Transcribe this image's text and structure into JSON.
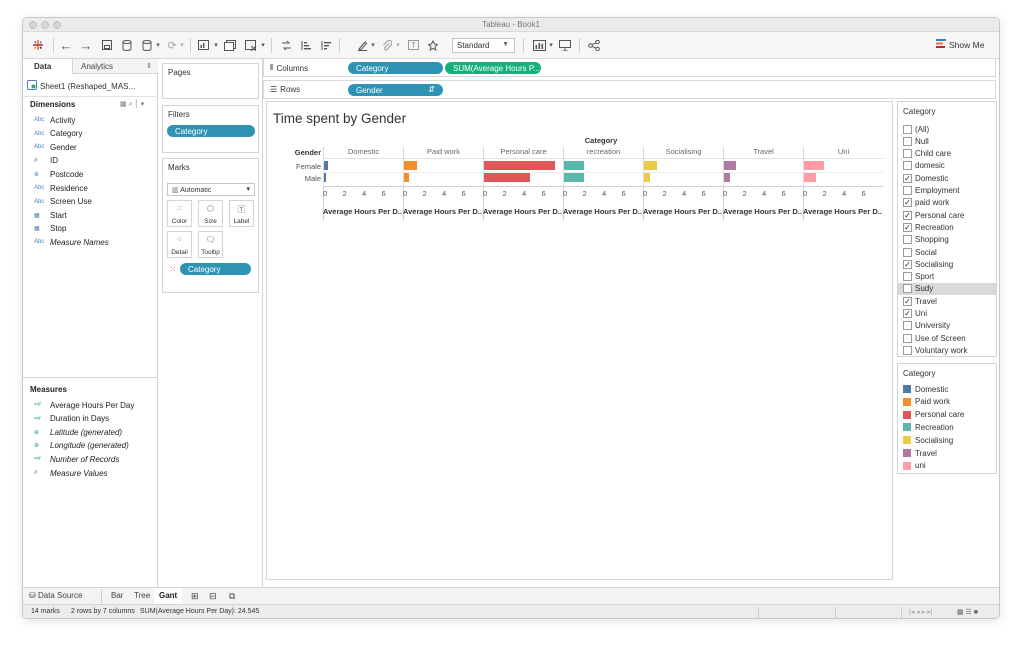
{
  "window": {
    "title": "Tableau - Book1"
  },
  "toolbar": {
    "zoom_select": "Standard",
    "show_me_label": "Show Me"
  },
  "sidebar": {
    "tab_data": "Data",
    "tab_analytics": "Analytics",
    "datasource": "Sheet1 (Reshaped_MAS...",
    "dimensions_title": "Dimensions",
    "dimensions": [
      {
        "type": "Abc",
        "name": "Activity"
      },
      {
        "type": "Abc",
        "name": "Category"
      },
      {
        "type": "Abc",
        "name": "Gender"
      },
      {
        "type": "#",
        "name": "ID"
      },
      {
        "type": "globe",
        "name": "Postcode"
      },
      {
        "type": "Abc",
        "name": "Residence"
      },
      {
        "type": "Abc",
        "name": "Screen Use"
      },
      {
        "type": "date",
        "name": "Start"
      },
      {
        "type": "date",
        "name": "Stop"
      },
      {
        "type": "Abc",
        "name": "Measure Names"
      }
    ],
    "measures_title": "Measures",
    "measures": [
      {
        "type": "=#",
        "name": "Average Hours Per Day"
      },
      {
        "type": "=#",
        "name": "Duration in Days"
      },
      {
        "type": "globe",
        "name": "Latitude (generated)"
      },
      {
        "type": "globe",
        "name": "Longitude (generated)"
      },
      {
        "type": "=#",
        "name": "Number of Records"
      },
      {
        "type": "#",
        "name": "Measure Values"
      }
    ]
  },
  "cards": {
    "pages": "Pages",
    "filters": "Filters",
    "filter_pill": "Category",
    "marks": "Marks",
    "mark_type": "Automatic",
    "mark_buttons": [
      "Color",
      "Size",
      "Label",
      "Detail",
      "Tooltip"
    ],
    "color_pill": "Category"
  },
  "shelves": {
    "columns_label": "Columns",
    "rows_label": "Rows",
    "col_pill_1": "Category",
    "col_pill_2": "SUM(Average Hours P...",
    "row_pill": "Gender"
  },
  "view": {
    "title": "Time spent by Gender",
    "category_header": "Category",
    "gender_header": "Gender",
    "axis_label": "Average Hours Per D..",
    "ticks": [
      "0",
      "2",
      "4",
      "6"
    ]
  },
  "chart_data": {
    "type": "bar",
    "title": "Time spent by Gender",
    "panel_header": "Category",
    "row_header": "Gender",
    "categories": [
      "Domestic",
      "Paid work",
      "Personal care",
      "recreation",
      "Socialising",
      "Travel",
      "Uni"
    ],
    "rows": [
      "Female",
      "Male"
    ],
    "series": [
      {
        "name": "Female",
        "values": [
          0.4,
          1.3,
          7.3,
          2.0,
          1.3,
          1.2,
          2.0
        ]
      },
      {
        "name": "Male",
        "values": [
          0.2,
          0.5,
          4.7,
          2.0,
          0.6,
          0.6,
          1.2
        ]
      }
    ],
    "colors": [
      "#4e79a7",
      "#f28e2b",
      "#e15759",
      "#59b8ab",
      "#edc948",
      "#b07aa1",
      "#ff9da7"
    ],
    "xlabel": "Average Hours Per D..",
    "ylabel": "",
    "xlim": [
      0,
      8
    ],
    "xticks": [
      0,
      2,
      4,
      6
    ],
    "grid": true
  },
  "filter_card": {
    "title": "Category",
    "items": [
      {
        "label": "(All)",
        "checked": false
      },
      {
        "label": "Null",
        "checked": false
      },
      {
        "label": "Child care",
        "checked": false
      },
      {
        "label": "domesic",
        "checked": false
      },
      {
        "label": "Domestic",
        "checked": true
      },
      {
        "label": "Employment",
        "checked": false
      },
      {
        "label": "paid work",
        "checked": true
      },
      {
        "label": "Personal care",
        "checked": true
      },
      {
        "label": "Recreation",
        "checked": true
      },
      {
        "label": "Shopping",
        "checked": false
      },
      {
        "label": "Social",
        "checked": false
      },
      {
        "label": "Socialising",
        "checked": true
      },
      {
        "label": "Sport",
        "checked": false
      },
      {
        "label": "Sudy",
        "checked": false
      },
      {
        "label": "Travel",
        "checked": true
      },
      {
        "label": "Uni",
        "checked": true
      },
      {
        "label": "University",
        "checked": false
      },
      {
        "label": "Use of Screen",
        "checked": false
      },
      {
        "label": "Voluntary work",
        "checked": false
      }
    ],
    "highlighted": "Sudy"
  },
  "legend": {
    "title": "Category",
    "items": [
      {
        "label": "Domestic",
        "color": "#4e79a7"
      },
      {
        "label": "Paid work",
        "color": "#f28e2b"
      },
      {
        "label": "Personal care",
        "color": "#e15759"
      },
      {
        "label": "Recreation",
        "color": "#59b8ab"
      },
      {
        "label": "Socialising",
        "color": "#edc948"
      },
      {
        "label": "Travel",
        "color": "#b07aa1"
      },
      {
        "label": "uni",
        "color": "#ff9da7"
      }
    ]
  },
  "sheet_tabs": {
    "datasource": "Data Source",
    "tabs": [
      "Bar",
      "Tree",
      "Gant"
    ],
    "active": "Gant"
  },
  "status": {
    "marks": "14 marks",
    "dims": "2 rows by 7 columns",
    "sum": "SUM(Average Hours Per Day): 24.545"
  }
}
